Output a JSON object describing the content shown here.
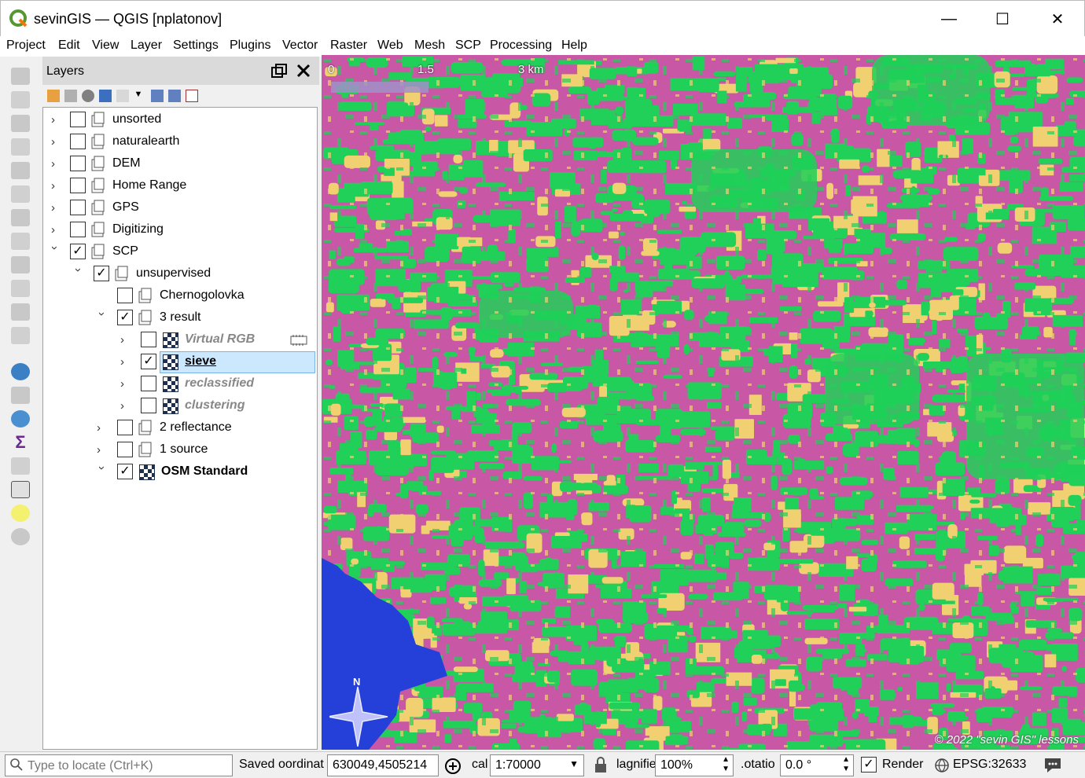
{
  "window": {
    "title": "sevinGIS — QGIS [nplatonov]",
    "minimize_glyph": "—",
    "maximize_glyph": "☐",
    "close_glyph": "✕"
  },
  "menu": [
    "Project",
    "Edit",
    "View",
    "Layer",
    "Settings",
    "Plugins",
    "Vector",
    "Raster",
    "Web",
    "Mesh",
    "SCP",
    "Processing",
    "Help"
  ],
  "layers_panel": {
    "title": "Layers",
    "items": [
      {
        "label": "unsorted",
        "checked": false,
        "expanded": false,
        "type": "group",
        "style": "normal"
      },
      {
        "label": "naturalearth",
        "checked": false,
        "expanded": false,
        "type": "group",
        "style": "normal"
      },
      {
        "label": "DEM",
        "checked": false,
        "expanded": false,
        "type": "group",
        "style": "normal"
      },
      {
        "label": "Home Range",
        "checked": false,
        "expanded": false,
        "type": "group",
        "style": "normal"
      },
      {
        "label": "GPS",
        "checked": false,
        "expanded": false,
        "type": "group",
        "style": "normal"
      },
      {
        "label": "Digitizing",
        "checked": false,
        "expanded": false,
        "type": "group",
        "style": "normal"
      },
      {
        "label": "SCP",
        "checked": true,
        "expanded": true,
        "type": "group",
        "style": "normal"
      },
      {
        "label": "unsupervised",
        "checked": true,
        "expanded": true,
        "type": "group",
        "style": "normal"
      },
      {
        "label": "Chernogolovka",
        "checked": false,
        "expanded": null,
        "type": "group",
        "style": "normal"
      },
      {
        "label": "3 result",
        "checked": true,
        "expanded": true,
        "type": "group",
        "style": "normal"
      },
      {
        "label": "Virtual RGB",
        "checked": false,
        "expanded": false,
        "type": "raster",
        "style": "italic"
      },
      {
        "label": "sieve",
        "checked": true,
        "expanded": false,
        "type": "raster",
        "style": "selected"
      },
      {
        "label": "reclassified",
        "checked": false,
        "expanded": false,
        "type": "raster",
        "style": "italic"
      },
      {
        "label": "clustering",
        "checked": false,
        "expanded": false,
        "type": "raster",
        "style": "italic"
      },
      {
        "label": "2 reflectance",
        "checked": false,
        "expanded": false,
        "type": "group",
        "style": "normal"
      },
      {
        "label": "1 source",
        "checked": false,
        "expanded": false,
        "type": "group",
        "style": "normal"
      },
      {
        "label": "OSM Standard",
        "checked": true,
        "expanded": true,
        "type": "raster",
        "style": "bold"
      }
    ]
  },
  "map": {
    "scalebar_labels": [
      "0",
      "1.5",
      "3 km"
    ],
    "north_label": "N",
    "copyright": "© 2022 \"sevin GIS\" lessons",
    "colors": {
      "urban": "#c857a5",
      "forest": "#20d058",
      "field": "#f0d070",
      "water": "#2540d8"
    }
  },
  "statusbar": {
    "locate_placeholder": "Type to locate (Ctrl+K)",
    "saved": "Saved",
    "coordinate_label": "oordinat",
    "coordinate_value": "630049,4505214",
    "scale_label": "cal",
    "scale_value": "1:70000",
    "magnifier_label": "lagnifie",
    "magnifier_value": "100%",
    "rotation_label": ".otatio",
    "rotation_value": "0.0 °",
    "render_label": "Render",
    "render_checked": true,
    "crs": "EPSG:32633"
  }
}
